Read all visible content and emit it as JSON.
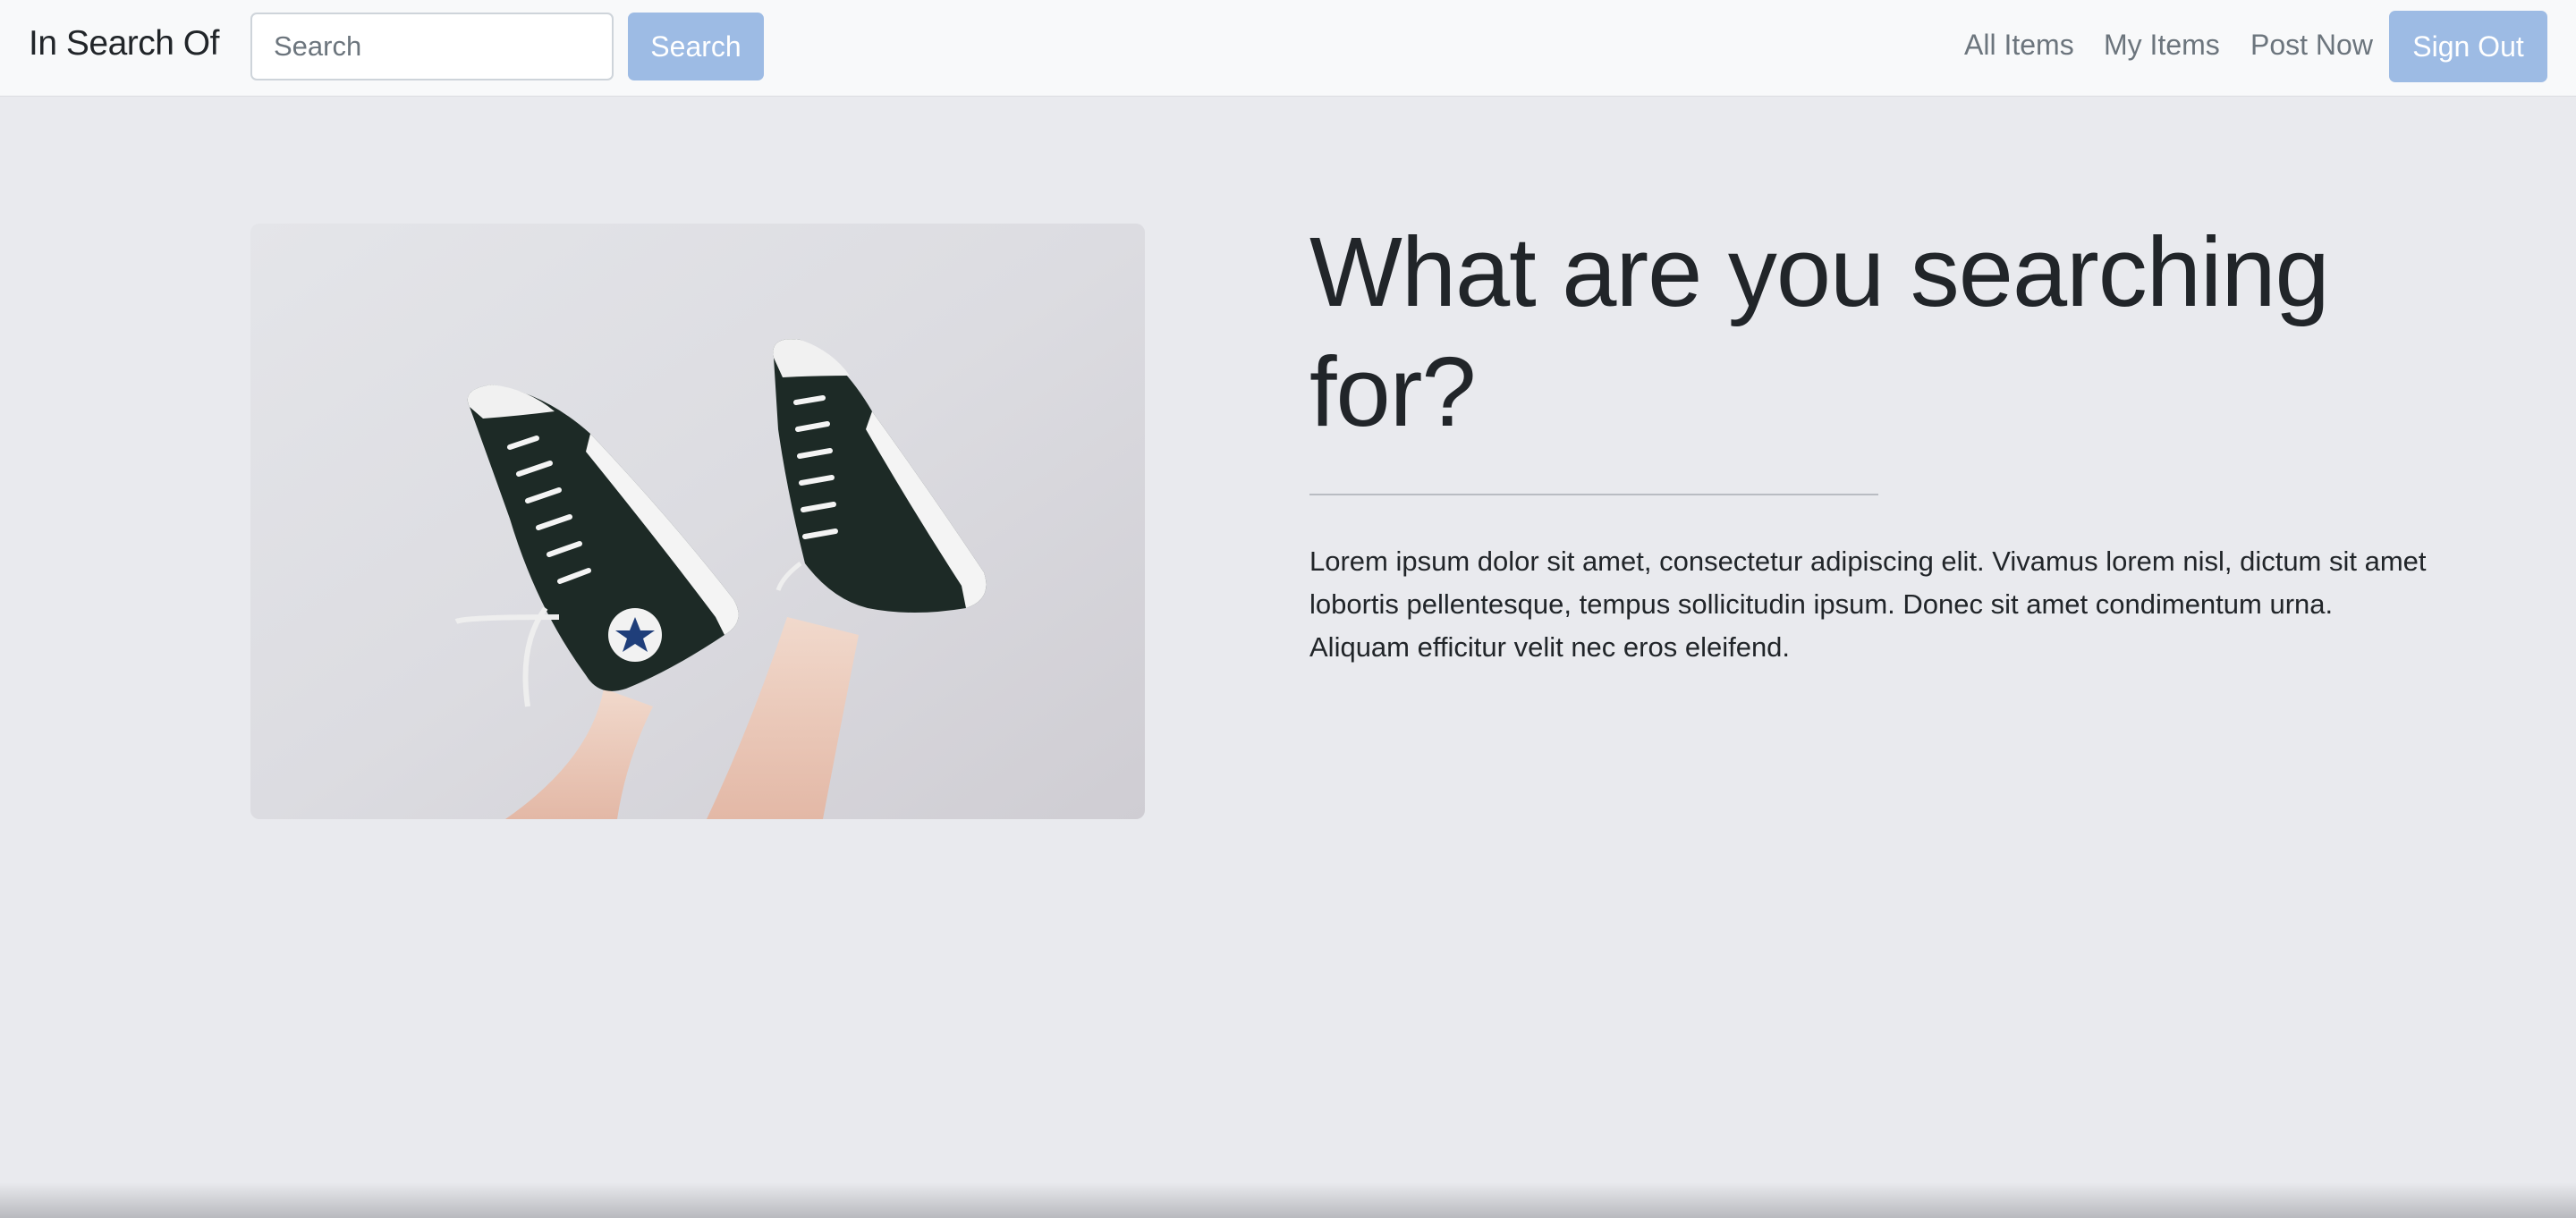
{
  "navbar": {
    "brand": "In Search Of",
    "search_placeholder": "Search",
    "search_button": "Search",
    "links": [
      "All Items",
      "My Items",
      "Post Now"
    ],
    "signout_button": "Sign Out"
  },
  "hero": {
    "image_alt": "sneaker-photo",
    "heading": "What are you searching for?",
    "paragraph": "Lorem ipsum dolor sit amet, consectetur adipiscing elit. Vivamus lorem nisl, dictum sit amet lobortis pellentesque, tempus sollicitudin ipsum. Donec sit amet condimentum urna. Aliquam efficitur velit nec eros eleifend."
  },
  "colors": {
    "accent": "#9dbbe4",
    "background": "#e9eaee",
    "navbar": "#f8f9fa"
  }
}
